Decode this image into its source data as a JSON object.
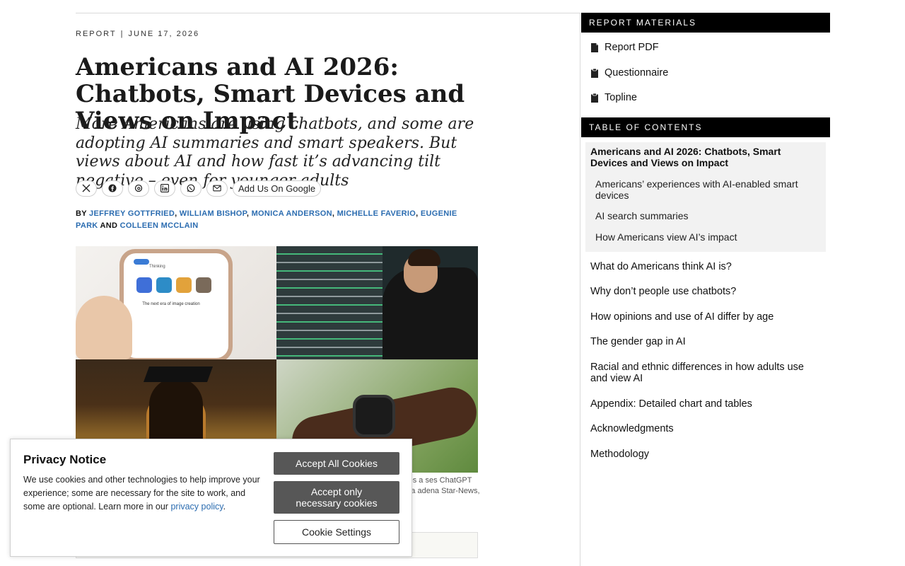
{
  "article": {
    "kicker": "REPORT",
    "date": "JUNE 17, 2026",
    "title": "Americans and AI 2026: Chatbots, Smart Devices and Views on Impact",
    "subtitle": "More Americans are using chatbots, and some are adopting AI summaries and smart speakers. But views about AI and how fast it’s advancing tilt negative – even for younger adults",
    "share": {
      "icons": [
        "x-icon",
        "facebook-icon",
        "threads-icon",
        "linkedin-icon",
        "whatsapp-icon",
        "email-icon"
      ],
      "google_label": "Add Us On Google"
    },
    "byline": {
      "prefix": "BY",
      "authors": [
        "JEFFREY GOTTFRIED",
        "WILLIAM BISHOP",
        "MONICA ANDERSON",
        "MICHELLE FAVERIO",
        "EUGENIE PARK",
        "COLLEEN MCCLAIN"
      ],
      "conjunction": "AND"
    },
    "hero": {
      "phone_caption": "The next era of image creation",
      "phone_status": "Thinking"
    },
    "caption": "uses a ses ChatGPT on a adena Star-News,"
  },
  "privacy": {
    "title": "Privacy Notice",
    "body": "We use cookies and other technologies to help improve your experience; some are necessary for the site to work, and some are optional. Learn more in our",
    "link": "privacy policy",
    "period": ".",
    "accept_all": "Accept All Cookies",
    "accept_necessary": "Accept only necessary cookies",
    "settings": "Cookie Settings"
  },
  "sidebar": {
    "materials_header": "REPORT MATERIALS",
    "materials": [
      "Report PDF",
      "Questionnaire",
      "Topline"
    ],
    "toc_header": "TABLE OF CONTENTS",
    "toc_current": "Americans and AI 2026: Chatbots, Smart Devices and Views on Impact",
    "toc_sub": [
      "Americans’ experiences with AI-enabled smart devices",
      "AI search summaries",
      "How Americans view AI’s impact"
    ],
    "toc_items": [
      "What do Americans think AI is?",
      "Why don’t people use chatbots?",
      "How opinions and use of AI differ by age",
      "The gender gap in AI",
      "Racial and ethnic differences in how adults use and view AI",
      "Appendix: Detailed chart and tables",
      "Acknowledgments",
      "Methodology"
    ]
  },
  "colors": {
    "link": "#2b6cb0",
    "header_bg": "#000000",
    "button_bg": "#575757"
  }
}
